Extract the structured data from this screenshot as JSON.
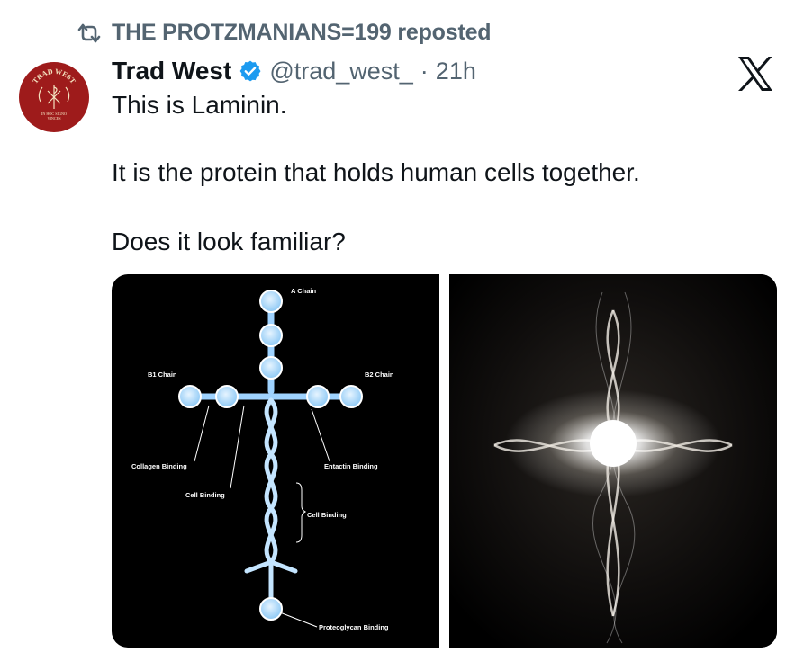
{
  "repost": {
    "text": "THE PROTZMANIANS=199 reposted",
    "icon": "repost-icon"
  },
  "author": {
    "name": "Trad West",
    "handle": "@trad_west_",
    "separator": "·",
    "time": "21h",
    "verified_color": "#1d9bf0"
  },
  "avatar_logo": {
    "top": "TRAD WEST",
    "bottom": "IN HOC SIGNO VINCES",
    "color": "#9e1b1b"
  },
  "post": {
    "line1": "This is Laminin.",
    "line2": "It is the protein that holds human cells together.",
    "line3": "Does it look familiar?"
  },
  "diagram": {
    "a_chain": "A Chain",
    "b1_chain": "B1 Chain",
    "b2_chain": "B2 Chain",
    "collagen_binding": "Collagen Binding",
    "cell_binding_1": "Cell Binding",
    "entactin_binding": "Entactin Binding",
    "cell_binding_2": "Cell Binding",
    "proteoglycan_binding": "Proteoglycan Binding"
  },
  "colors": {
    "muted": "#536471",
    "text": "#0f1419",
    "node": "#a8d8ff"
  }
}
